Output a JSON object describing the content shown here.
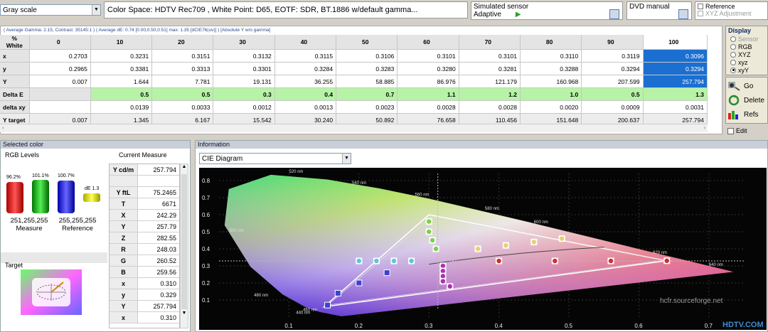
{
  "toolbar": {
    "mode_select": "Gray scale",
    "colorspace_text": "Color Space: HDTV Rec709 , White Point: D65, EOTF:  SDR, BT.1886 w/default gamma...",
    "sensor_title": "Simulated sensor",
    "sensor_value": "Adaptive",
    "generator_title": "DVD manual",
    "reference_label": "Reference",
    "xyz_adjust_label": "XYZ Adjustment"
  },
  "summary_line": "( Average Gamma: 2.15, Contrast: 35145:1 ) ( Average dE: 0.74 [0.00,0.50,0.51] max: 1.35 [dCIE76(uv)] ) [Absolute Y w/o gamma]",
  "grid": {
    "corner": "% White",
    "columns": [
      "0",
      "10",
      "20",
      "30",
      "40",
      "50",
      "60",
      "70",
      "80",
      "90",
      "100"
    ],
    "rows": [
      {
        "label": "x",
        "cells": [
          "0.2703",
          "0.3231",
          "0.3151",
          "0.3132",
          "0.3115",
          "0.3106",
          "0.3101",
          "0.3101",
          "0.3110",
          "0.3119",
          "0.3096"
        ]
      },
      {
        "label": "y",
        "cells": [
          "0.2965",
          "0.3381",
          "0.3313",
          "0.3301",
          "0.3284",
          "0.3283",
          "0.3280",
          "0.3281",
          "0.3288",
          "0.3294",
          "0.3294"
        ]
      },
      {
        "label": "Y",
        "cells": [
          "0.007",
          "1.644",
          "7.781",
          "19.131",
          "36.255",
          "58.885",
          "86.976",
          "121.179",
          "160.968",
          "207.599",
          "257.794"
        ]
      },
      {
        "label": "Delta E",
        "cells": [
          "",
          "0.5",
          "0.5",
          "0.3",
          "0.4",
          "0.7",
          "1.1",
          "1.2",
          "1.0",
          "0.5",
          "1.3"
        ]
      },
      {
        "label": "delta xy",
        "cells": [
          "",
          "0.0139",
          "0.0033",
          "0.0012",
          "0.0013",
          "0.0023",
          "0.0028",
          "0.0028",
          "0.0020",
          "0.0009",
          "0.0031"
        ]
      },
      {
        "label": "Y target",
        "cells": [
          "0.007",
          "1.345",
          "6.167",
          "15.542",
          "30.240",
          "50.892",
          "76.658",
          "110.456",
          "151.648",
          "200.637",
          "257.794"
        ]
      }
    ]
  },
  "display_panel": {
    "title": "Display",
    "options": [
      "Sensor",
      "RGB",
      "XYZ",
      "xyz",
      "xyY"
    ],
    "selected": "xyY",
    "go_label": "Go",
    "delete_label": "Delete",
    "refs_label": "Refs",
    "edit_label": "Edit"
  },
  "selected_color": {
    "title": "Selected color",
    "rgb_levels_label": "RGB Levels",
    "bar_values": [
      "96.2%",
      "101.1%",
      "100.7%"
    ],
    "de_label": "dE 1.3",
    "measure_value": "251,255,255",
    "measure_label": "Measure",
    "reference_value": "255,255,255",
    "reference_label": "Reference",
    "target_label": "Target",
    "current_measure_label": "Current Measure",
    "measure_rows": [
      {
        "label": "Y cd/m",
        "value": "257.794"
      },
      {
        "label": "",
        "value": ""
      },
      {
        "label": "Y ftL",
        "value": "75.2465"
      },
      {
        "label": "T",
        "value": "6671"
      },
      {
        "label": "X",
        "value": "242.29"
      },
      {
        "label": "Y",
        "value": "257.79"
      },
      {
        "label": "Z",
        "value": "282.55"
      },
      {
        "label": "R",
        "value": "248.03"
      },
      {
        "label": "G",
        "value": "260.52"
      },
      {
        "label": "B",
        "value": "259.56"
      },
      {
        "label": "x",
        "value": "0.310"
      },
      {
        "label": "y",
        "value": "0.329"
      },
      {
        "label": "Y",
        "value": "257.794"
      },
      {
        "label": "x",
        "value": "0.310"
      }
    ]
  },
  "information": {
    "title": "Information",
    "diagram_select": "CIE Diagram",
    "y_ticks": [
      "0.8",
      "0.7",
      "0.6",
      "0.5",
      "0.4",
      "0.3",
      "0.2",
      "0.1"
    ],
    "x_ticks": [
      "0.1",
      "0.2",
      "0.3",
      "0.4",
      "0.5",
      "0.6",
      "0.7"
    ],
    "wavelengths": [
      "520 nm",
      "540 nm",
      "560 nm",
      "580 nm",
      "600 nm",
      "620 nm",
      "640 nm",
      "500 nm",
      "480 nm",
      "460 nm",
      "440 nm"
    ],
    "watermark": "hcfr.sourceforge.net",
    "corner_logo": "HDTV.COM"
  }
}
